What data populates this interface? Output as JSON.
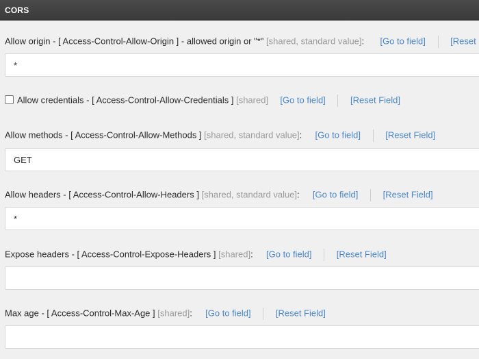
{
  "section": {
    "title": "CORS"
  },
  "fields": {
    "allow_origin": {
      "label": "Allow origin - [ Access-Control-Allow-Origin ] - allowed origin or \"*\"",
      "meta": "[shared, standard value]",
      "colon": ":",
      "goto": "[Go to field]",
      "reset": "[Reset Field]",
      "value": "*"
    },
    "allow_credentials": {
      "label": "Allow credentials - [ Access-Control-Allow-Credentials ]",
      "meta": "[shared]",
      "goto": "[Go to field]",
      "reset": "[Reset Field]",
      "checked": false
    },
    "allow_methods": {
      "label": "Allow methods - [ Access-Control-Allow-Methods ]",
      "meta": "[shared, standard value]",
      "colon": ":",
      "goto": "[Go to field]",
      "reset": "[Reset Field]",
      "value": "GET"
    },
    "allow_headers": {
      "label": "Allow headers - [ Access-Control-Allow-Headers ]",
      "meta": "[shared, standard value]",
      "colon": ":",
      "goto": "[Go to field]",
      "reset": "[Reset Field]",
      "value": "*"
    },
    "expose_headers": {
      "label": "Expose headers - [ Access-Control-Expose-Headers ]",
      "meta": "[shared]",
      "colon": ":",
      "goto": "[Go to field]",
      "reset": "[Reset Field]",
      "value": ""
    },
    "max_age": {
      "label": "Max age - [ Access-Control-Max-Age ]",
      "meta": "[shared]",
      "colon": ":",
      "goto": "[Go to field]",
      "reset": "[Reset Field]",
      "value": ""
    }
  },
  "colors": {
    "header_bg": "#3d3d3d",
    "link": "#4a86c7",
    "meta": "#9a9a9a",
    "page_bg": "#f0f0f0"
  }
}
